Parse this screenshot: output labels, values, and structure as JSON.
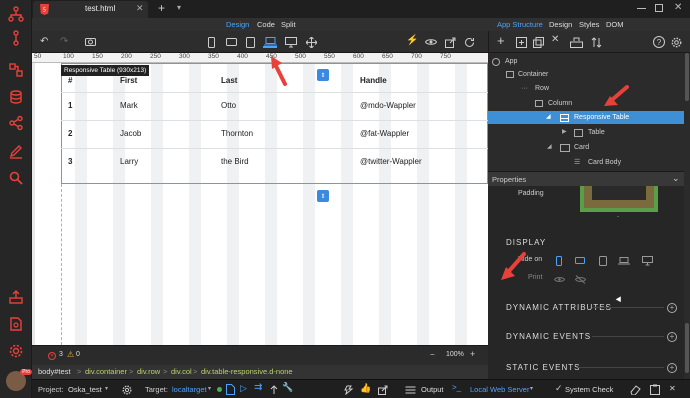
{
  "tab": {
    "title": "test.html"
  },
  "menu": {
    "design": "Design",
    "code": "Code",
    "split": "Split",
    "app_structure": "App Structure",
    "design_r": "Design",
    "styles": "Styles",
    "dom": "DOM"
  },
  "ruler": {
    "ticks": [
      "50",
      "100",
      "150",
      "200",
      "250",
      "300",
      "350",
      "400",
      "450",
      "500",
      "550",
      "600",
      "650",
      "700",
      "750"
    ]
  },
  "canvas": {
    "tooltip": "Responsive Table (930x213)",
    "headers": [
      "#",
      "First",
      "Last",
      "Handle"
    ],
    "rows": [
      [
        "1",
        "Mark",
        "Otto",
        "@mdo-Wappler"
      ],
      [
        "2",
        "Jacob",
        "Thornton",
        "@fat-Wappler"
      ],
      [
        "3",
        "Larry",
        "the Bird",
        "@twitter-Wappler"
      ]
    ]
  },
  "tree": {
    "nodes": [
      {
        "label": "App",
        "level": 0,
        "arrow": ""
      },
      {
        "label": "Container",
        "level": 1,
        "arrow": ""
      },
      {
        "label": "Row",
        "level": 2,
        "arrow": ""
      },
      {
        "label": "Column",
        "level": 3,
        "arrow": ""
      },
      {
        "label": "Responsive Table",
        "level": 4,
        "arrow": "down",
        "selected": true
      },
      {
        "label": "Table",
        "level": 5,
        "arrow": "right"
      },
      {
        "label": "Card",
        "level": 4,
        "arrow": "down"
      },
      {
        "label": "Card Body",
        "level": 5,
        "arrow": ""
      }
    ]
  },
  "props": {
    "header": "Properties",
    "padding_label": "Padding",
    "padding_dash": "-",
    "display": "DISPLAY",
    "hide_on": "Hide on",
    "print": "Print",
    "dyn_attrs": "DYNAMIC ATTRIBUTES",
    "dyn_events": "DYNAMIC EVENTS",
    "static_events": "STATIC EVENTS"
  },
  "status": {
    "errors": "3",
    "warnings": "0",
    "zoom": "100%",
    "zoom_minus": "−",
    "zoom_plus": "+"
  },
  "breadcrumb": [
    "body#test",
    "div.container",
    "div.row",
    "div.col",
    "div.table-responsive.d-none"
  ],
  "bottom": {
    "project_label": "Project:",
    "project": "Oska_test",
    "target_label": "Target:",
    "target": "localtarget",
    "output": "Output",
    "server": "Local Web Server",
    "system_check": "System Check",
    "avatar_badge": "Pro"
  },
  "colors": {
    "accent": "#4aa3ff",
    "selected": "#3d8fd6",
    "arrow": "#e8413a",
    "handle_blue": "#3a8be0"
  }
}
